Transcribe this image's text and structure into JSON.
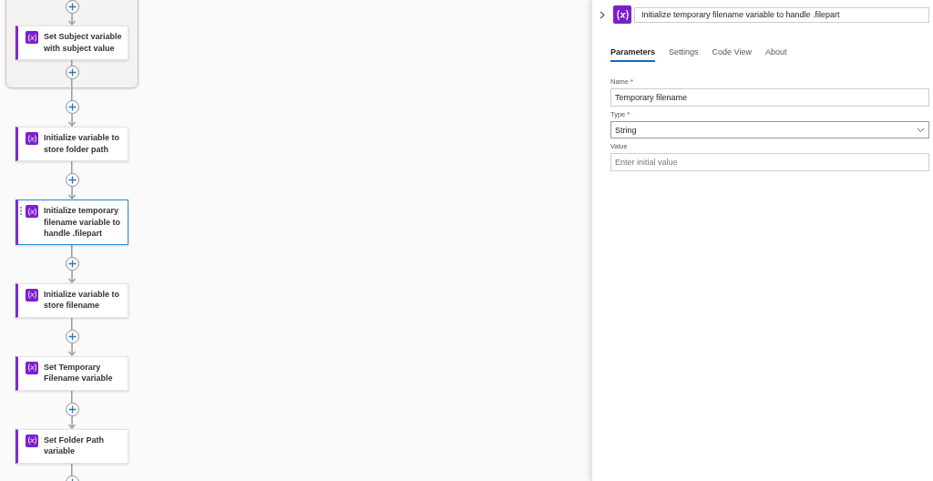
{
  "canvas": {
    "scope": {
      "steps": [
        {
          "title": "Set Subject variable with subject value",
          "selected": false
        }
      ]
    },
    "steps": [
      {
        "title": "Initialize variable to store folder path",
        "selected": false
      },
      {
        "title": "Initialize temporary filename variable to handle .filepart",
        "selected": true
      },
      {
        "title": "Initialize variable to store filename",
        "selected": false
      },
      {
        "title": "Set Temporary Filename variable",
        "selected": false
      },
      {
        "title": "Set Folder Path variable",
        "selected": false
      }
    ]
  },
  "panel": {
    "title": "Initialize temporary filename variable to handle .filepart",
    "tabs": [
      {
        "label": "Parameters",
        "selected": true
      },
      {
        "label": "Settings",
        "selected": false
      },
      {
        "label": "Code View",
        "selected": false
      },
      {
        "label": "About",
        "selected": false
      }
    ],
    "fields": [
      {
        "kind": "text",
        "label": "Name",
        "required_mark": "*",
        "value": "Temporary filename"
      },
      {
        "kind": "select",
        "label": "Type",
        "required_mark": "*",
        "value": "String"
      },
      {
        "kind": "text",
        "label": "Value",
        "placeholder": "Enter initial value"
      }
    ]
  }
}
